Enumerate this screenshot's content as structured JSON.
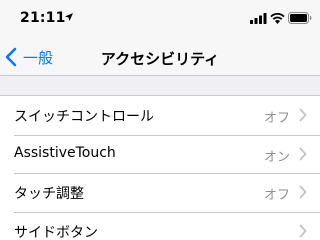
{
  "status_bar": {
    "time": "21:11"
  },
  "nav": {
    "back_label": "一般",
    "title": "アクセシビリティ"
  },
  "settings": [
    {
      "label": "スイッチコントロール",
      "value": "オフ"
    },
    {
      "label": "AssistiveTouch",
      "value": "オン"
    },
    {
      "label": "タッチ調整",
      "value": "オフ"
    },
    {
      "label": "サイドボタン",
      "value": ""
    }
  ],
  "colors": {
    "accent": "#007aff",
    "background": "#efeff4",
    "secondary_text": "#8e8e93",
    "separator": "#c8c7cc"
  },
  "icons": [
    "location-arrow-icon",
    "signal-icon",
    "wifi-icon",
    "battery-icon",
    "chevron-left-icon",
    "chevron-right-icon"
  ]
}
